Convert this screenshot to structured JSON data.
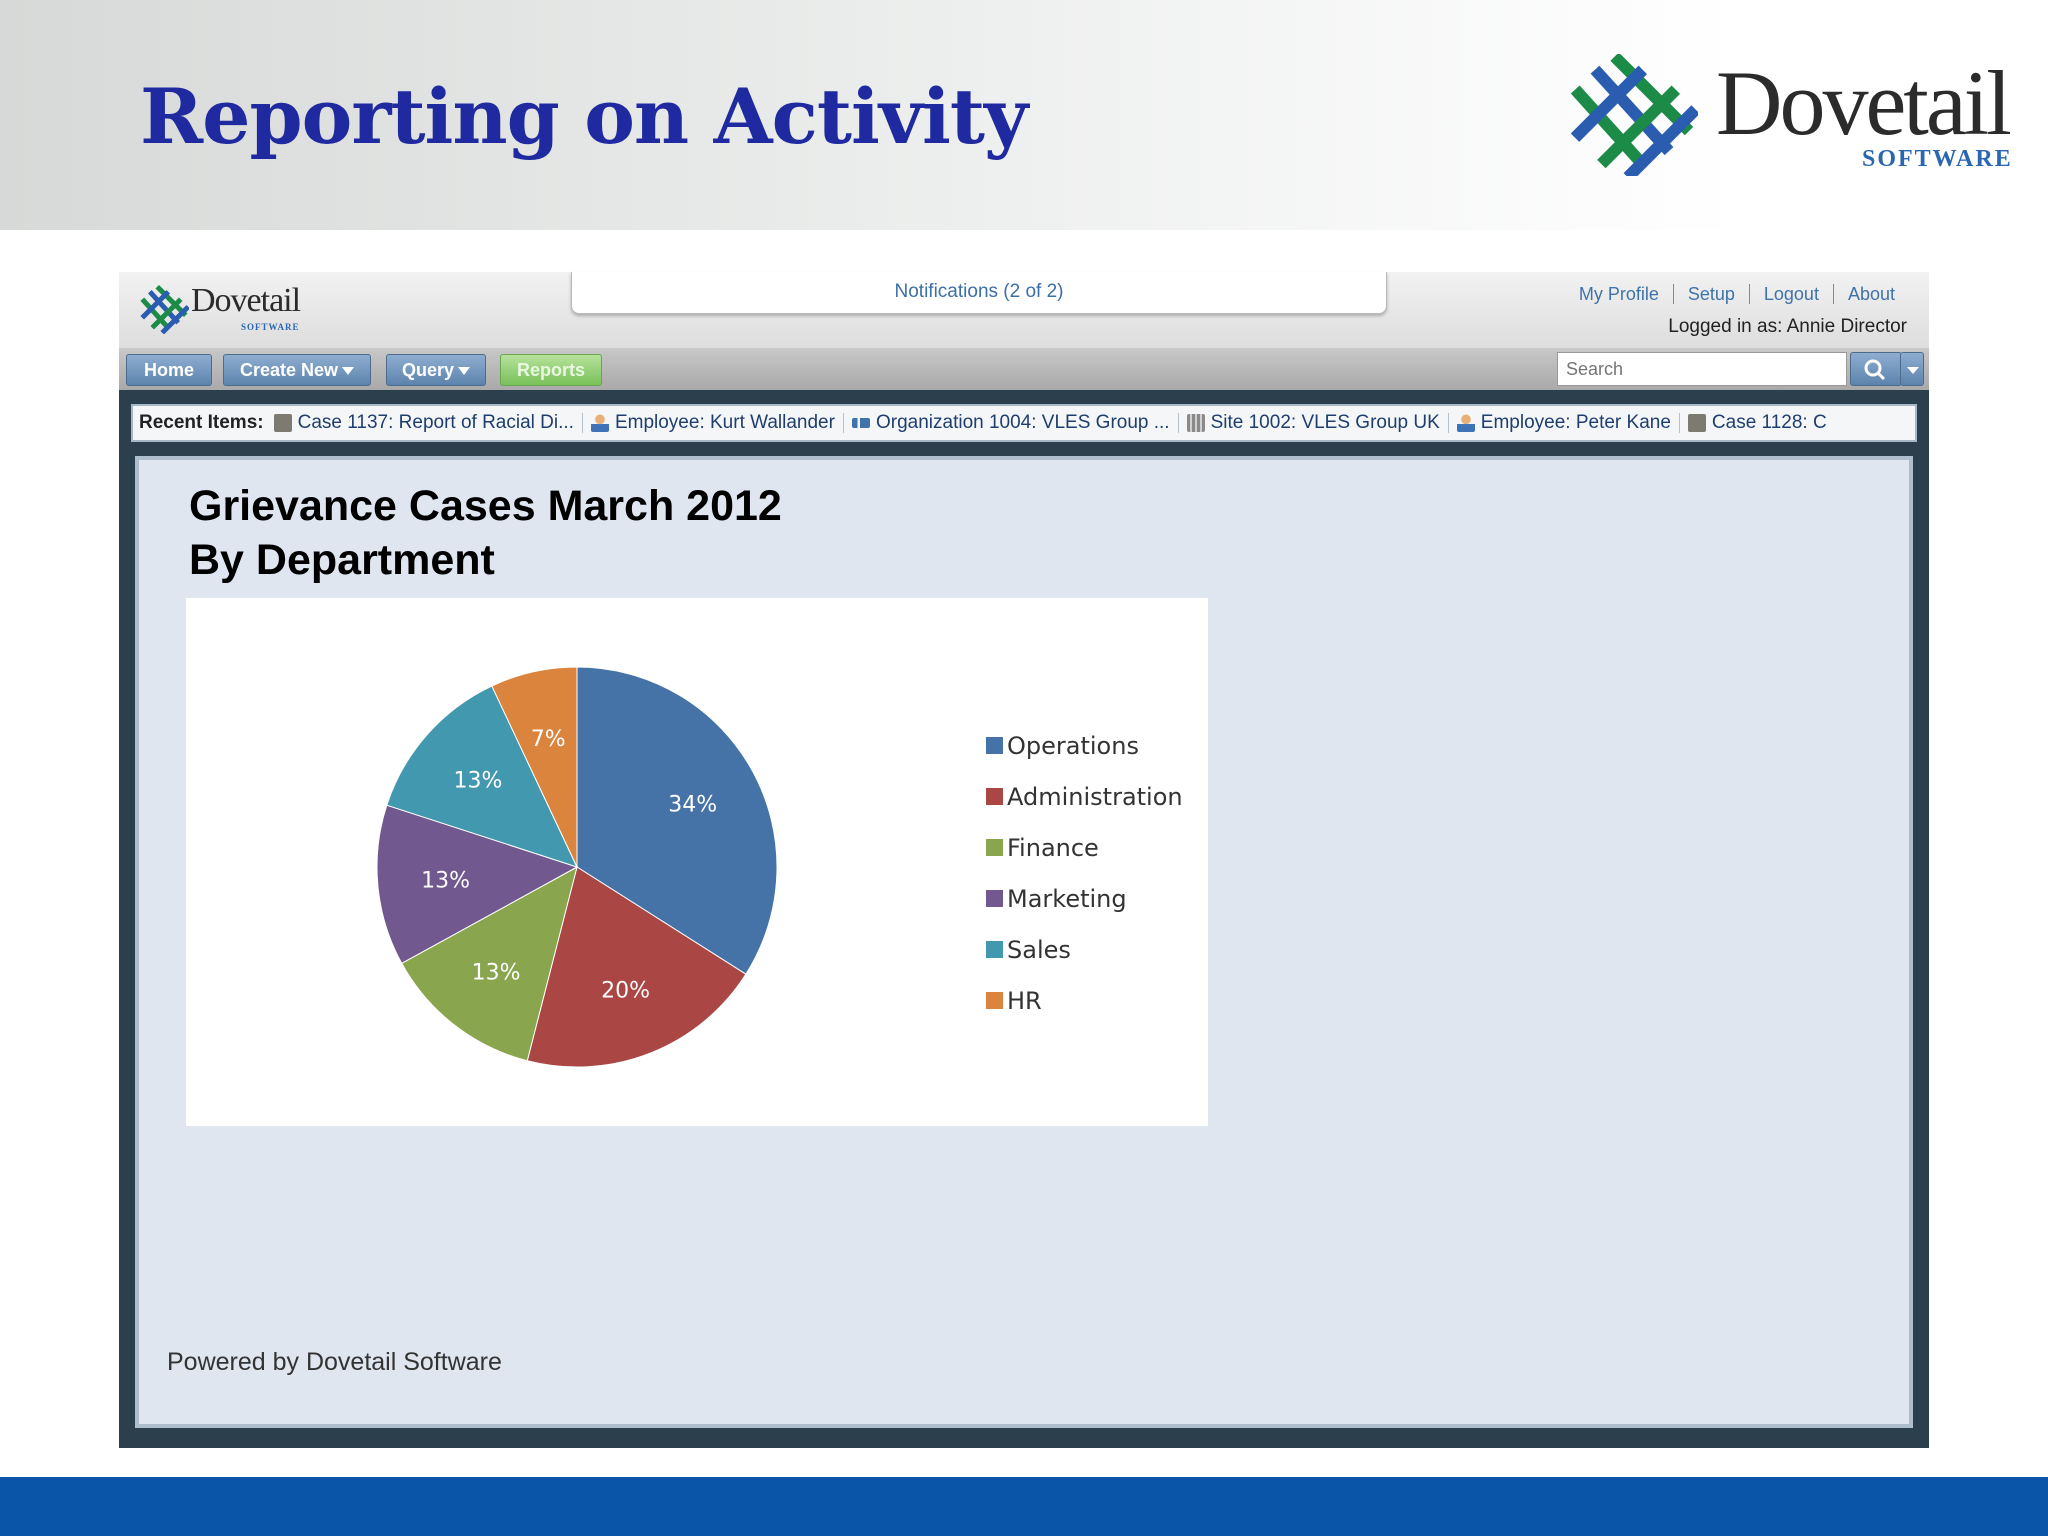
{
  "slide": {
    "title": "Reporting on Activity",
    "brand_name": "Dovetail",
    "brand_sub": "SOFTWARE",
    "footer_color": "#0b55a8"
  },
  "app": {
    "logo_name": "Dovetail",
    "logo_sub": "SOFTWARE",
    "notifications": "Notifications (2 of 2)",
    "top_links": [
      "My Profile",
      "Setup",
      "Logout",
      "About"
    ],
    "logged_in": "Logged in as: Annie Director",
    "nav": {
      "home": "Home",
      "create_new": "Create New",
      "query": "Query",
      "reports": "Reports"
    },
    "search": {
      "placeholder": "Search"
    },
    "recent": {
      "label": "Recent Items:",
      "items": [
        {
          "icon": "case-icon",
          "text": "Case 1137: Report of Racial Di..."
        },
        {
          "icon": "employee-icon",
          "text": "Employee: Kurt Wallander"
        },
        {
          "icon": "organization-icon",
          "text": "Organization 1004: VLES Group ..."
        },
        {
          "icon": "site-icon",
          "text": "Site 1002: VLES Group UK"
        },
        {
          "icon": "employee-icon",
          "text": "Employee: Peter Kane"
        },
        {
          "icon": "case-icon",
          "text": "Case 1128: C"
        }
      ]
    },
    "report": {
      "title_line1": "Grievance Cases March 2012",
      "title_line2": "By Department"
    },
    "powered_by": "Powered by Dovetail Software"
  },
  "chart_data": {
    "type": "pie",
    "title": "Grievance Cases March 2012 By Department",
    "legend_position": "right",
    "slices": [
      {
        "label": "Operations",
        "value": 34,
        "display": "34%",
        "color": "#4572a7"
      },
      {
        "label": "Administration",
        "value": 20,
        "display": "20%",
        "color": "#aa4643"
      },
      {
        "label": "Finance",
        "value": 13,
        "display": "13%",
        "color": "#89a54e"
      },
      {
        "label": "Marketing",
        "value": 13,
        "display": "13%",
        "color": "#71588f"
      },
      {
        "label": "Sales",
        "value": 13,
        "display": "13%",
        "color": "#4198af"
      },
      {
        "label": "HR",
        "value": 7,
        "display": "7%",
        "color": "#db843d"
      }
    ]
  }
}
